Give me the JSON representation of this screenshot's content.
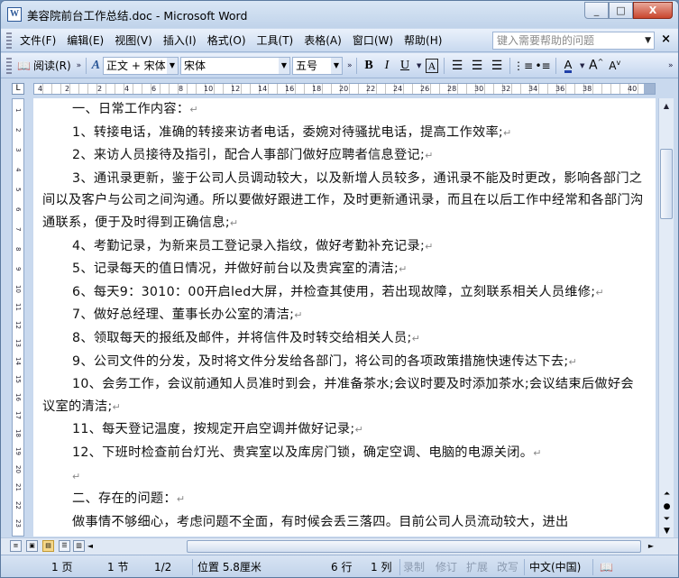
{
  "window": {
    "app_icon": "W",
    "title": "美容院前台工作总结.doc - Microsoft Word",
    "controls": [
      "_",
      "□",
      "X"
    ]
  },
  "menu": {
    "items": [
      "文件(F)",
      "编辑(E)",
      "视图(V)",
      "插入(I)",
      "格式(O)",
      "工具(T)",
      "表格(A)",
      "窗口(W)",
      "帮助(H)"
    ],
    "help_placeholder": "键入需要帮助的问题",
    "close_doc": "×"
  },
  "toolbar": {
    "read_label": "阅读(R)",
    "style_value": "正文 + 宋体",
    "font_value": "宋体",
    "size_value": "五号",
    "bold": "B",
    "italic": "I",
    "underline": "U",
    "charbox": "A",
    "font_color": "A"
  },
  "ruler": {
    "corner": "L",
    "labels": [
      "4",
      "2",
      "2",
      "4",
      "6",
      "8",
      "10",
      "12",
      "14",
      "16",
      "18",
      "20",
      "22",
      "24",
      "26",
      "28",
      "30",
      "32",
      "34",
      "36",
      "38",
      "40"
    ],
    "vlabels": [
      "1",
      "2",
      "3",
      "4",
      "5",
      "6",
      "7",
      "8",
      "9",
      "10",
      "11",
      "12",
      "13",
      "14",
      "15",
      "16",
      "17",
      "18",
      "19",
      "20",
      "21",
      "22",
      "23"
    ]
  },
  "document": {
    "paragraphs": [
      {
        "text": "一、日常工作内容：",
        "indent": true
      },
      {
        "text": "1、转接电话，准确的转接来访者电话，委婉对待骚扰电话，提高工作效率;",
        "indent": true
      },
      {
        "text": "2、来访人员接待及指引，配合人事部门做好应聘者信息登记;",
        "indent": true
      },
      {
        "text": "3、通讯录更新，鉴于公司人员调动较大，以及新增人员较多，通讯录不能及时更改，影响各部门之间以及客户与公司之间沟通。所以要做好跟进工作，及时更新通讯录，而且在以后工作中经常和各部门沟通联系，便于及时得到正确信息;",
        "indent": true
      },
      {
        "text": "4、考勤记录，为新来员工登记录入指纹，做好考勤补充记录;",
        "indent": true
      },
      {
        "text": "5、记录每天的值日情况，并做好前台以及贵宾室的清洁;",
        "indent": true
      },
      {
        "text": "6、每天9：3010：00开启led大屏，并检查其使用，若出现故障，立刻联系相关人员维修;",
        "indent": true
      },
      {
        "text": "7、做好总经理、董事长办公室的清洁;",
        "indent": true
      },
      {
        "text": "8、领取每天的报纸及邮件，并将信件及时转交给相关人员;",
        "indent": true
      },
      {
        "text": "9、公司文件的分发，及时将文件分发给各部门，将公司的各项政策措施快速传达下去;",
        "indent": true
      },
      {
        "text": "10、会务工作，会议前通知人员准时到会，并准备茶水;会议时要及时添加茶水;会议结束后做好会议室的清洁;",
        "indent": true
      },
      {
        "text": "11、每天登记温度，按规定开启空调并做好记录;",
        "indent": true
      },
      {
        "text": "12、下班时检查前台灯光、贵宾室以及库房门锁，确定空调、电脑的电源关闭。",
        "indent": true
      },
      {
        "text": "",
        "indent": true
      },
      {
        "text": "二、存在的问题：",
        "indent": true
      },
      {
        "text": "做事情不够细心，考虑问题不全面，有时候会丢三落四。目前公司人员流动较大，进出",
        "indent": true
      }
    ],
    "para_mark": "↵"
  },
  "status": {
    "page": "1 页",
    "section": "1 节",
    "pages": "1/2",
    "position": "位置 5.8厘米",
    "line": "6 行",
    "column": "1 列",
    "rec": "录制",
    "trk": "修订",
    "ext": "扩展",
    "ovr": "改写",
    "language": "中文(中国)"
  }
}
